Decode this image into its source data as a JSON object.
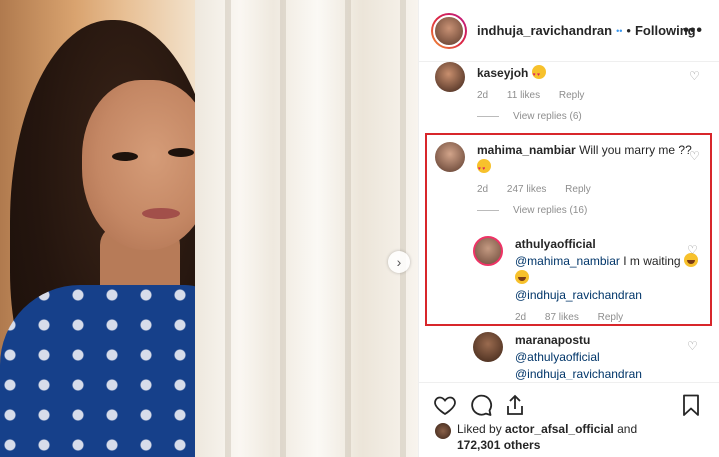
{
  "post": {
    "username": "indhuja_ravichandran",
    "verified_mark": "••",
    "separator": "•",
    "follow_status": "Following",
    "more_icon": "more-horizontal-icon",
    "next_icon": "chevron-right-icon"
  },
  "comments": [
    {
      "username": "kaseyjoh",
      "text": "",
      "emoji": "heart-eyes",
      "age": "2d",
      "likes": "11 likes",
      "reply_label": "Reply",
      "view_replies": "View replies (6)"
    },
    {
      "username": "mahima_nambiar",
      "text": "Will you marry me ??",
      "emoji": "heart-eyes",
      "age": "2d",
      "likes": "247 likes",
      "reply_label": "Reply",
      "view_replies": "View replies (16)"
    }
  ],
  "replies": [
    {
      "username": "athulyaofficial",
      "mention": "@mahima_nambiar",
      "text": "I m waiting",
      "emoji": "laugh",
      "mention2": "@indhuja_ravichandran",
      "age": "2d",
      "likes": "87 likes",
      "reply_label": "Reply"
    },
    {
      "username": "maranapostu",
      "mention": "@athulyaofficial",
      "mention2": "@indhuja_ravichandran"
    }
  ],
  "actions": {
    "like_icon": "heart-icon",
    "comment_icon": "comment-icon",
    "share_icon": "share-icon",
    "save_icon": "bookmark-icon",
    "liked_prefix": "Liked by",
    "liked_user": "actor_afsal_official",
    "liked_and": "and",
    "liked_count": "172,301 others"
  },
  "colors": {
    "accent_link": "#003569",
    "meta_gray": "#8e8e8e",
    "highlight_border": "#d8262b",
    "verified_blue": "#3897f0"
  }
}
